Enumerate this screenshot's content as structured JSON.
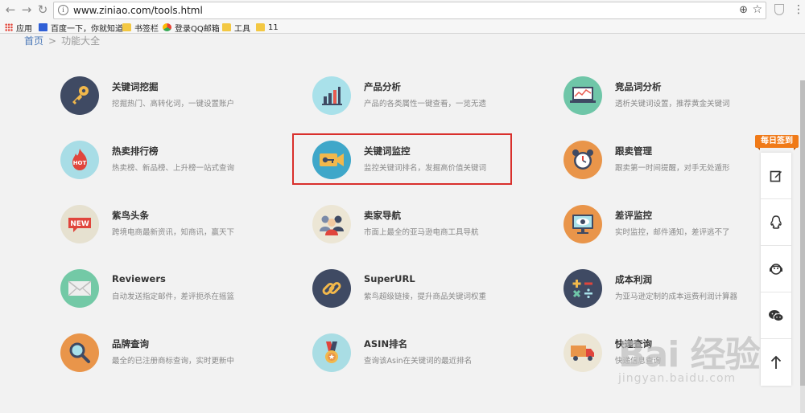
{
  "browser": {
    "url": "www.ziniao.com/tools.html",
    "bookmarks": [
      {
        "label": "应用",
        "icon": "apps-icon"
      },
      {
        "label": "百度一下，你就知道",
        "icon": "baidu-icon"
      },
      {
        "label": "书签栏",
        "icon": "folder-icon"
      },
      {
        "label": "登录QQ邮箱",
        "icon": "qq-mail-icon"
      },
      {
        "label": "工具",
        "icon": "folder-icon"
      },
      {
        "label": "11",
        "icon": "folder-icon"
      }
    ]
  },
  "breadcrumb": {
    "home": "首页",
    "separator": ">",
    "current": "功能大全"
  },
  "tools": [
    {
      "title": "关键词挖掘",
      "desc": "挖掘热门、高转化词，一键设置账户",
      "icon": "key-icon",
      "color": "#3f4a63"
    },
    {
      "title": "产品分析",
      "desc": "产品的各类属性一键查看，一览无遗",
      "icon": "bar-chart-icon",
      "color": "#a9e1ea"
    },
    {
      "title": "竞品词分析",
      "desc": "透析关键词设置，推荐黄金关键词",
      "icon": "laptop-chart-icon",
      "color": "#6fc6a8"
    },
    {
      "title": "热卖排行榜",
      "desc": "热卖榜、新品榜、上升榜一站式查询",
      "icon": "hot-flame-icon",
      "color": "#a8dde6"
    },
    {
      "title": "关键词监控",
      "desc": "监控关键词排名，发掘高价值关键词",
      "icon": "key-camera-icon",
      "color": "#3fa7c9"
    },
    {
      "title": "跟卖管理",
      "desc": "跟卖第一时间提醒，对手无处遁形",
      "icon": "alarm-clock-icon",
      "color": "#e9954a"
    },
    {
      "title": "紫鸟头条",
      "desc": "跨境电商最新资讯，知商讯，赢天下",
      "icon": "new-badge-icon",
      "color": "#e6e1d0"
    },
    {
      "title": "卖家导航",
      "desc": "市面上最全的亚马逊电商工具导航",
      "icon": "people-icon",
      "color": "#ece6d5"
    },
    {
      "title": "差评监控",
      "desc": "实时监控，邮件通知，差评逃不了",
      "icon": "monitor-eye-icon",
      "color": "#e9954a"
    },
    {
      "title": "Reviewers",
      "desc": "自动发送指定邮件，差评扼杀在摇篮",
      "icon": "envelope-icon",
      "color": "#73c9a6"
    },
    {
      "title": "SuperURL",
      "desc": "紫鸟超级链接，提升商品关键词权重",
      "icon": "link-icon",
      "color": "#3f4a63"
    },
    {
      "title": "成本利润",
      "desc": "为亚马逊定制的成本运费利润计算器",
      "icon": "calculator-icon",
      "color": "#3f4a63"
    },
    {
      "title": "品牌查询",
      "desc": "最全的已注册商标查询，实时更新中",
      "icon": "magnifier-icon",
      "color": "#e9954a"
    },
    {
      "title": "ASIN排名",
      "desc": "查询该Asin在关键词的最近排名",
      "icon": "medal-icon",
      "color": "#a9dde4"
    },
    {
      "title": "快递查询",
      "desc": "快递信息查询",
      "icon": "truck-icon",
      "color": "#ece6d5"
    }
  ],
  "side_panel": {
    "sign_in_label": "每日签到",
    "buttons": [
      "edit-icon",
      "qq-icon",
      "service-icon",
      "wechat-icon",
      "back-to-top-icon"
    ]
  },
  "watermark": {
    "main": "Bai 经验",
    "sub": "jingyan.baidu.com"
  }
}
